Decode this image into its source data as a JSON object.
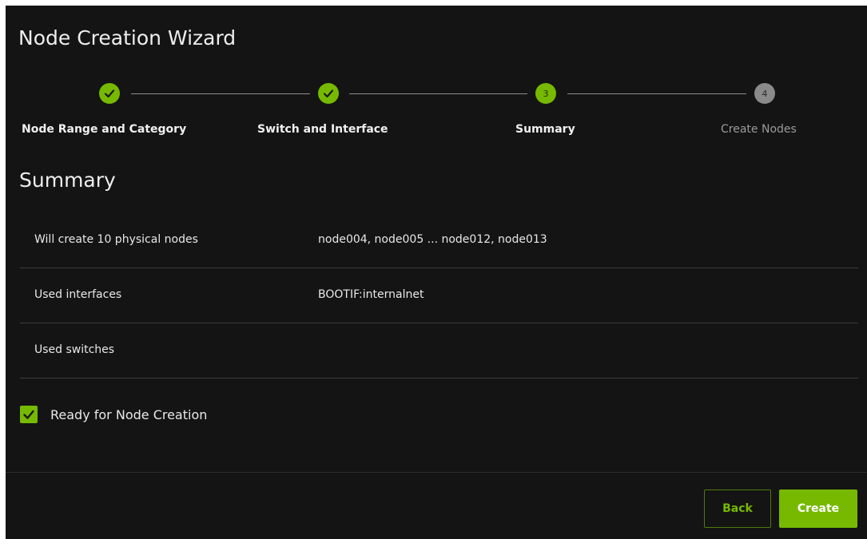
{
  "dialog": {
    "title": "Node Creation Wizard"
  },
  "stepper": {
    "steps": [
      {
        "label": "Node Range and Category",
        "number": "1",
        "state": "completed",
        "icon": "check-icon"
      },
      {
        "label": "Switch and Interface",
        "number": "2",
        "state": "completed",
        "icon": "check-icon"
      },
      {
        "label": "Summary",
        "number": "3",
        "state": "current"
      },
      {
        "label": "Create Nodes",
        "number": "4",
        "state": "pending"
      }
    ]
  },
  "summary": {
    "heading": "Summary",
    "rows": [
      {
        "label": "Will create 10 physical nodes",
        "value": "node004, node005 ... node012, node013"
      },
      {
        "label": "Used interfaces",
        "value": "BOOTIF:internalnet"
      },
      {
        "label": "Used switches",
        "value": ""
      }
    ]
  },
  "ready_checkbox": {
    "label": "Ready for Node Creation",
    "checked": true,
    "icon": "check-icon"
  },
  "footer": {
    "back_label": "Back",
    "create_label": "Create"
  },
  "colors": {
    "accent": "#76b900",
    "background": "#141414",
    "pending_step": "#8a8a8a"
  }
}
